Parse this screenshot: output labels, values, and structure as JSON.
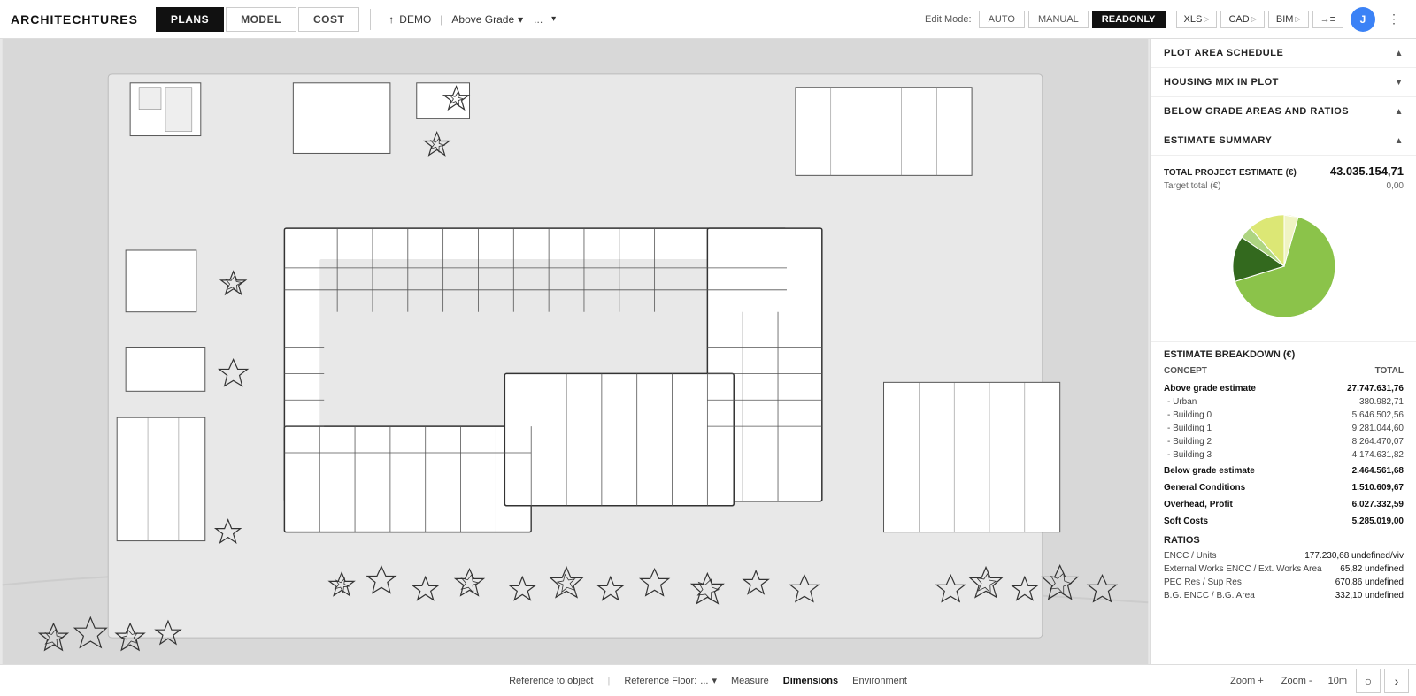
{
  "logo": {
    "text_arch": "ARCHITE",
    "text_ch": "CH",
    "text_tures": "TURES"
  },
  "nav": {
    "tabs": [
      {
        "id": "plans",
        "label": "PLANS",
        "active": true
      },
      {
        "id": "model",
        "label": "MODEL",
        "active": false
      },
      {
        "id": "cost",
        "label": "COST",
        "active": false
      }
    ],
    "demo_label": "DEMO",
    "above_grade": "Above Grade",
    "dots": "...",
    "edit_mode_label": "Edit Mode:",
    "edit_modes": [
      {
        "id": "auto",
        "label": "AUTO",
        "active": false
      },
      {
        "id": "manual",
        "label": "MANUAL",
        "active": false
      },
      {
        "id": "readonly",
        "label": "READONLY",
        "active": true
      }
    ],
    "export_btns": [
      {
        "id": "xls",
        "label": "XLS"
      },
      {
        "id": "cad",
        "label": "CAD"
      },
      {
        "id": "bim",
        "label": "BIM"
      },
      {
        "id": "arrow",
        "label": "→≡"
      }
    ],
    "user_initial": "J"
  },
  "right_panel": {
    "sections": [
      {
        "id": "plot-area",
        "label": "PLOT AREA SCHEDULE",
        "expanded": false
      },
      {
        "id": "housing-mix",
        "label": "HOUSING MIX IN PLOT",
        "expanded": false
      },
      {
        "id": "below-grade",
        "label": "BELOW GRADE AREAS AND RATIOS",
        "expanded": false
      },
      {
        "id": "estimate-summary",
        "label": "ESTIMATE SUMMARY",
        "expanded": true
      }
    ],
    "estimate": {
      "total_label": "TOTAL PROJECT ESTIMATE (€)",
      "total_value": "43.035.154,71",
      "target_label": "Target total (€)",
      "target_value": "0,00"
    },
    "breakdown_title": "ESTIMATE BREAKDOWN (€)",
    "breakdown_headers": [
      "CONCEPT",
      "TOTAL"
    ],
    "breakdown_rows": [
      {
        "label": "Above grade estimate",
        "value": "27.747.631,76",
        "bold": true,
        "sub": false
      },
      {
        "label": "- Urban",
        "value": "380.982,71",
        "bold": false,
        "sub": true
      },
      {
        "label": "- Building 0",
        "value": "5.646.502,56",
        "bold": false,
        "sub": true
      },
      {
        "label": "- Building 1",
        "value": "9.281.044,60",
        "bold": false,
        "sub": true
      },
      {
        "label": "- Building 2",
        "value": "8.264.470,07",
        "bold": false,
        "sub": true
      },
      {
        "label": "- Building 3",
        "value": "4.174.631,82",
        "bold": false,
        "sub": true
      },
      {
        "label": "Below grade estimate",
        "value": "2.464.561,68",
        "bold": true,
        "sub": false
      },
      {
        "label": "General Conditions",
        "value": "1.510.609,67",
        "bold": true,
        "sub": false
      },
      {
        "label": "Overhead, Profit",
        "value": "6.027.332,59",
        "bold": true,
        "sub": false
      },
      {
        "label": "Soft Costs",
        "value": "5.285.019,00",
        "bold": true,
        "sub": false
      }
    ],
    "ratios_title": "RATIOS",
    "ratios": [
      {
        "label": "ENCC / Units",
        "value": "177.230,68 undefined/viv"
      },
      {
        "label": "External Works ENCC / Ext. Works Area",
        "value": "65,82 undefined"
      },
      {
        "label": "PEC Res / Sup Res",
        "value": "670,86 undefined"
      },
      {
        "label": "B.G. ENCC / B.G. Area",
        "value": "332,10 undefined"
      }
    ],
    "pie_chart": {
      "segments": [
        {
          "label": "Above grade",
          "value": 27.747631,
          "color": "#8bc34a"
        },
        {
          "label": "Below grade",
          "value": 2.464561,
          "color": "#33691e"
        },
        {
          "label": "General Conditions",
          "value": 1.510609,
          "color": "#aed581"
        },
        {
          "label": "Overhead Profit",
          "value": 6.027332,
          "color": "#dce775"
        },
        {
          "label": "Soft Costs",
          "value": 5.285019,
          "color": "#f9fbe7"
        }
      ]
    }
  },
  "bottom_bar": {
    "reference_to_object": "Reference to object",
    "reference_floor_label": "Reference Floor:",
    "reference_floor_value": "...",
    "measure": "Measure",
    "dimensions": "Dimensions",
    "environment": "Environment",
    "zoom_in": "Zoom +",
    "zoom_out": "Zoom -",
    "zoom_level": "10m"
  }
}
